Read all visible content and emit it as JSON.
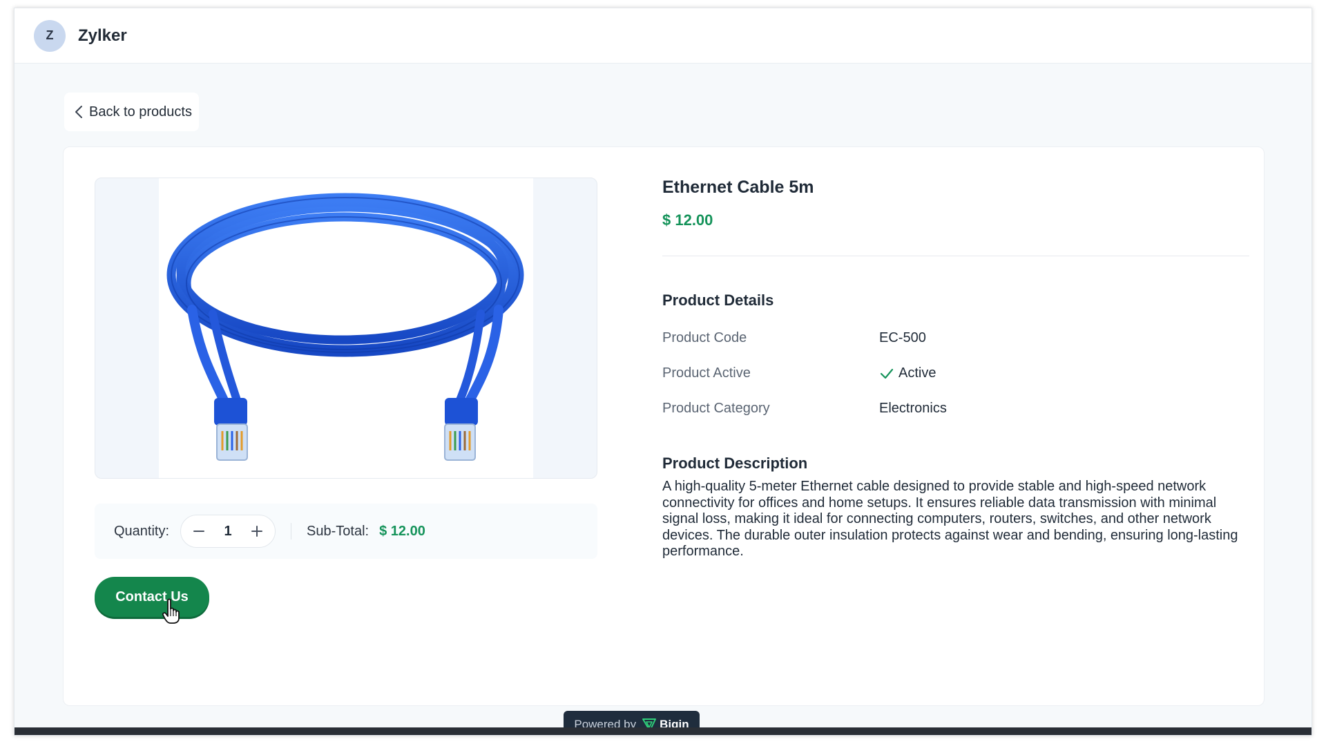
{
  "header": {
    "avatar_letter": "Z",
    "brand_name": "Zylker"
  },
  "nav": {
    "back_label": "Back to products"
  },
  "product": {
    "title": "Ethernet Cable 5m",
    "price": "$ 12.00",
    "details_heading": "Product Details",
    "details": [
      {
        "label": "Product Code",
        "value": "EC-500"
      },
      {
        "label": "Product Active",
        "value": "Active"
      },
      {
        "label": "Product Category",
        "value": "Electronics"
      }
    ],
    "description_heading": "Product Description",
    "description": "A high-quality 5-meter Ethernet cable designed to provide stable and high-speed network connectivity for offices and home setups. It ensures reliable data transmission with minimal signal loss, making it ideal for connecting computers, routers, switches, and other network devices. The durable outer insulation protects against wear and bending, ensuring long-lasting performance."
  },
  "cart": {
    "quantity_label": "Quantity:",
    "quantity_value": "1",
    "subtotal_label": "Sub-Total:",
    "subtotal_value": "$ 12.00"
  },
  "actions": {
    "contact_label": "Contact Us"
  },
  "footer": {
    "powered_by": "Powered by",
    "platform": "Bigin"
  },
  "colors": {
    "accent_green": "#15935a",
    "button_green": "#14864c",
    "cable_blue": "#1f5fe0"
  },
  "icons": {
    "back": "chevron-left-icon",
    "minus": "minus-icon",
    "plus": "plus-icon",
    "active": "check-icon",
    "cursor": "hand-pointer-icon",
    "platform_logo": "bigin-logo-icon"
  }
}
